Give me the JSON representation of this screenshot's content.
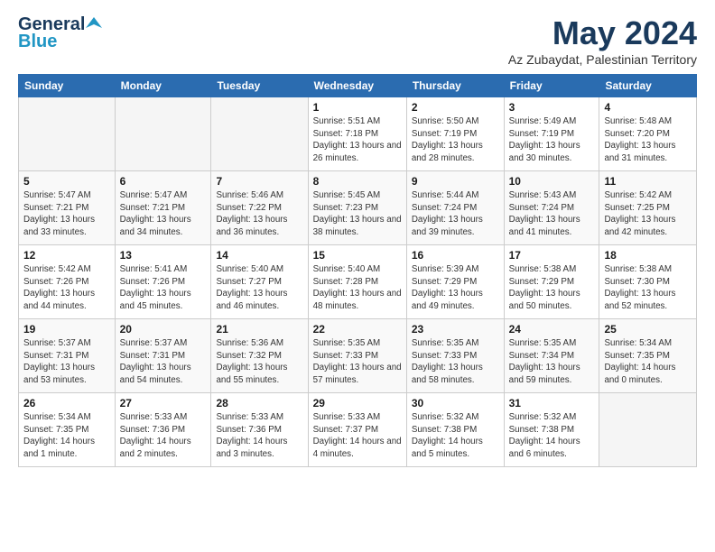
{
  "header": {
    "logo_general": "General",
    "logo_blue": "Blue",
    "title": "May 2024",
    "subtitle": "Az Zubaydat, Palestinian Territory"
  },
  "days_of_week": [
    "Sunday",
    "Monday",
    "Tuesday",
    "Wednesday",
    "Thursday",
    "Friday",
    "Saturday"
  ],
  "weeks": [
    [
      {
        "day": "",
        "sunrise": "",
        "sunset": "",
        "daylight": ""
      },
      {
        "day": "",
        "sunrise": "",
        "sunset": "",
        "daylight": ""
      },
      {
        "day": "",
        "sunrise": "",
        "sunset": "",
        "daylight": ""
      },
      {
        "day": "1",
        "sunrise": "Sunrise: 5:51 AM",
        "sunset": "Sunset: 7:18 PM",
        "daylight": "Daylight: 13 hours and 26 minutes."
      },
      {
        "day": "2",
        "sunrise": "Sunrise: 5:50 AM",
        "sunset": "Sunset: 7:19 PM",
        "daylight": "Daylight: 13 hours and 28 minutes."
      },
      {
        "day": "3",
        "sunrise": "Sunrise: 5:49 AM",
        "sunset": "Sunset: 7:19 PM",
        "daylight": "Daylight: 13 hours and 30 minutes."
      },
      {
        "day": "4",
        "sunrise": "Sunrise: 5:48 AM",
        "sunset": "Sunset: 7:20 PM",
        "daylight": "Daylight: 13 hours and 31 minutes."
      }
    ],
    [
      {
        "day": "5",
        "sunrise": "Sunrise: 5:47 AM",
        "sunset": "Sunset: 7:21 PM",
        "daylight": "Daylight: 13 hours and 33 minutes."
      },
      {
        "day": "6",
        "sunrise": "Sunrise: 5:47 AM",
        "sunset": "Sunset: 7:21 PM",
        "daylight": "Daylight: 13 hours and 34 minutes."
      },
      {
        "day": "7",
        "sunrise": "Sunrise: 5:46 AM",
        "sunset": "Sunset: 7:22 PM",
        "daylight": "Daylight: 13 hours and 36 minutes."
      },
      {
        "day": "8",
        "sunrise": "Sunrise: 5:45 AM",
        "sunset": "Sunset: 7:23 PM",
        "daylight": "Daylight: 13 hours and 38 minutes."
      },
      {
        "day": "9",
        "sunrise": "Sunrise: 5:44 AM",
        "sunset": "Sunset: 7:24 PM",
        "daylight": "Daylight: 13 hours and 39 minutes."
      },
      {
        "day": "10",
        "sunrise": "Sunrise: 5:43 AM",
        "sunset": "Sunset: 7:24 PM",
        "daylight": "Daylight: 13 hours and 41 minutes."
      },
      {
        "day": "11",
        "sunrise": "Sunrise: 5:42 AM",
        "sunset": "Sunset: 7:25 PM",
        "daylight": "Daylight: 13 hours and 42 minutes."
      }
    ],
    [
      {
        "day": "12",
        "sunrise": "Sunrise: 5:42 AM",
        "sunset": "Sunset: 7:26 PM",
        "daylight": "Daylight: 13 hours and 44 minutes."
      },
      {
        "day": "13",
        "sunrise": "Sunrise: 5:41 AM",
        "sunset": "Sunset: 7:26 PM",
        "daylight": "Daylight: 13 hours and 45 minutes."
      },
      {
        "day": "14",
        "sunrise": "Sunrise: 5:40 AM",
        "sunset": "Sunset: 7:27 PM",
        "daylight": "Daylight: 13 hours and 46 minutes."
      },
      {
        "day": "15",
        "sunrise": "Sunrise: 5:40 AM",
        "sunset": "Sunset: 7:28 PM",
        "daylight": "Daylight: 13 hours and 48 minutes."
      },
      {
        "day": "16",
        "sunrise": "Sunrise: 5:39 AM",
        "sunset": "Sunset: 7:29 PM",
        "daylight": "Daylight: 13 hours and 49 minutes."
      },
      {
        "day": "17",
        "sunrise": "Sunrise: 5:38 AM",
        "sunset": "Sunset: 7:29 PM",
        "daylight": "Daylight: 13 hours and 50 minutes."
      },
      {
        "day": "18",
        "sunrise": "Sunrise: 5:38 AM",
        "sunset": "Sunset: 7:30 PM",
        "daylight": "Daylight: 13 hours and 52 minutes."
      }
    ],
    [
      {
        "day": "19",
        "sunrise": "Sunrise: 5:37 AM",
        "sunset": "Sunset: 7:31 PM",
        "daylight": "Daylight: 13 hours and 53 minutes."
      },
      {
        "day": "20",
        "sunrise": "Sunrise: 5:37 AM",
        "sunset": "Sunset: 7:31 PM",
        "daylight": "Daylight: 13 hours and 54 minutes."
      },
      {
        "day": "21",
        "sunrise": "Sunrise: 5:36 AM",
        "sunset": "Sunset: 7:32 PM",
        "daylight": "Daylight: 13 hours and 55 minutes."
      },
      {
        "day": "22",
        "sunrise": "Sunrise: 5:35 AM",
        "sunset": "Sunset: 7:33 PM",
        "daylight": "Daylight: 13 hours and 57 minutes."
      },
      {
        "day": "23",
        "sunrise": "Sunrise: 5:35 AM",
        "sunset": "Sunset: 7:33 PM",
        "daylight": "Daylight: 13 hours and 58 minutes."
      },
      {
        "day": "24",
        "sunrise": "Sunrise: 5:35 AM",
        "sunset": "Sunset: 7:34 PM",
        "daylight": "Daylight: 13 hours and 59 minutes."
      },
      {
        "day": "25",
        "sunrise": "Sunrise: 5:34 AM",
        "sunset": "Sunset: 7:35 PM",
        "daylight": "Daylight: 14 hours and 0 minutes."
      }
    ],
    [
      {
        "day": "26",
        "sunrise": "Sunrise: 5:34 AM",
        "sunset": "Sunset: 7:35 PM",
        "daylight": "Daylight: 14 hours and 1 minute."
      },
      {
        "day": "27",
        "sunrise": "Sunrise: 5:33 AM",
        "sunset": "Sunset: 7:36 PM",
        "daylight": "Daylight: 14 hours and 2 minutes."
      },
      {
        "day": "28",
        "sunrise": "Sunrise: 5:33 AM",
        "sunset": "Sunset: 7:36 PM",
        "daylight": "Daylight: 14 hours and 3 minutes."
      },
      {
        "day": "29",
        "sunrise": "Sunrise: 5:33 AM",
        "sunset": "Sunset: 7:37 PM",
        "daylight": "Daylight: 14 hours and 4 minutes."
      },
      {
        "day": "30",
        "sunrise": "Sunrise: 5:32 AM",
        "sunset": "Sunset: 7:38 PM",
        "daylight": "Daylight: 14 hours and 5 minutes."
      },
      {
        "day": "31",
        "sunrise": "Sunrise: 5:32 AM",
        "sunset": "Sunset: 7:38 PM",
        "daylight": "Daylight: 14 hours and 6 minutes."
      },
      {
        "day": "",
        "sunrise": "",
        "sunset": "",
        "daylight": ""
      }
    ]
  ]
}
